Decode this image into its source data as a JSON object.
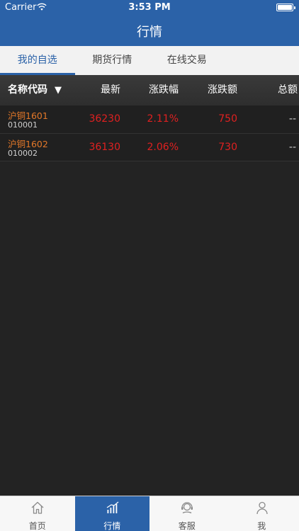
{
  "status_bar": {
    "carrier": "Carrier",
    "time": "3:53 PM"
  },
  "nav": {
    "title": "行情"
  },
  "tabs": [
    {
      "label": "我的自选",
      "active": true
    },
    {
      "label": "期货行情",
      "active": false
    },
    {
      "label": "在线交易",
      "active": false
    }
  ],
  "table": {
    "headers": {
      "name": "名称代码",
      "sort_indicator": "▼",
      "latest": "最新",
      "change_pct": "涨跌幅",
      "change_amt": "涨跌额",
      "total": "总额"
    },
    "rows": [
      {
        "name": "沪铜1601",
        "code": "010001",
        "latest": "36230",
        "change_pct": "2.11%",
        "change_amt": "750",
        "total": "--"
      },
      {
        "name": "沪铜1602",
        "code": "010002",
        "latest": "36130",
        "change_pct": "2.06%",
        "change_amt": "730",
        "total": "--"
      }
    ]
  },
  "tabbar": [
    {
      "label": "首页",
      "icon": "home-icon",
      "active": false
    },
    {
      "label": "行情",
      "icon": "chart-icon",
      "active": true
    },
    {
      "label": "客服",
      "icon": "headset-icon",
      "active": false
    },
    {
      "label": "我",
      "icon": "person-icon",
      "active": false
    }
  ],
  "colors": {
    "brand_blue": "#2b62a8",
    "up_red": "#e02020",
    "name_orange": "#e37829",
    "background": "#232323"
  }
}
